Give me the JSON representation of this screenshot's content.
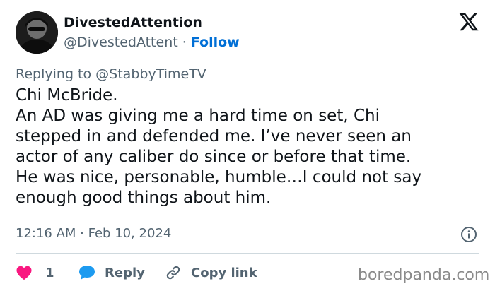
{
  "author": {
    "display_name": "DivestedAttention",
    "handle": "@DivestedAttent",
    "separator": "·",
    "follow_label": "Follow"
  },
  "reply_context": {
    "prefix": "Replying to",
    "mention": "@StabbyTimeTV"
  },
  "tweet": {
    "lines": [
      "Chi McBride.",
      "An AD was giving me a hard time on set, Chi",
      "stepped in and defended me. I’ve never seen an",
      "actor of any caliber do since or before that time.",
      "He was nice, personable, humble…I could not say",
      "enough good things about him."
    ],
    "timestamp": "12:16 AM · Feb 10, 2024"
  },
  "actions": {
    "like_count": "1",
    "reply_label": "Reply",
    "copy_label": "Copy link"
  },
  "watermark": "boredpanda.com",
  "icons": {
    "logo": "x-logo-icon",
    "like": "heart-icon",
    "reply": "speech-bubble-icon",
    "copy": "link-icon",
    "info": "info-icon"
  },
  "colors": {
    "text": "#0f1419",
    "muted": "#536471",
    "link": "#006fd6",
    "like": "#f91880",
    "reply": "#1d9bf0",
    "divider": "#cfd9de",
    "watermark": "#8a8a8a"
  }
}
